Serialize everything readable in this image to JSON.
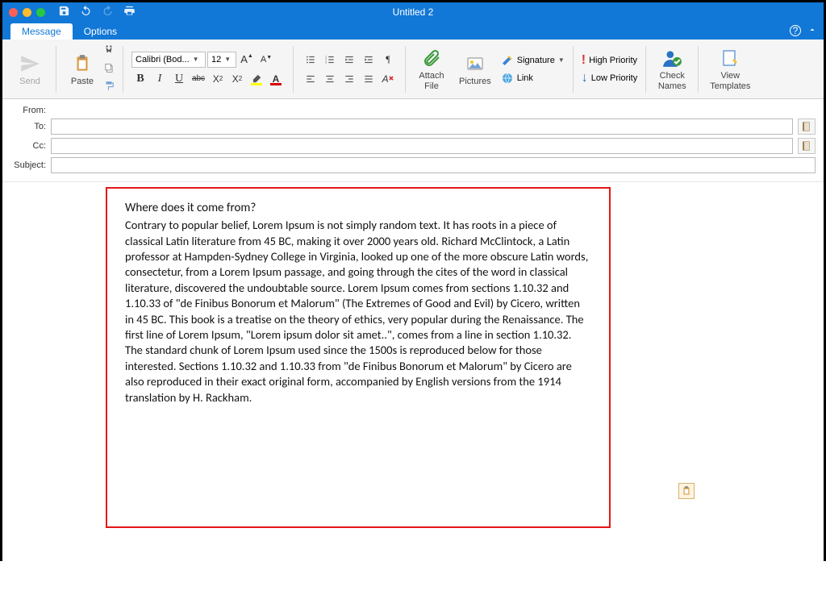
{
  "window": {
    "title": "Untitled 2"
  },
  "tabs": {
    "message": "Message",
    "options": "Options"
  },
  "ribbon": {
    "send": "Send",
    "paste": "Paste",
    "font_name": "Calibri (Bod...",
    "font_size": "12",
    "attach_file": "Attach\nFile",
    "pictures": "Pictures",
    "signature": "Signature",
    "link": "Link",
    "high_priority": "High Priority",
    "low_priority": "Low Priority",
    "check_names": "Check\nNames",
    "view_templates": "View\nTemplates"
  },
  "fields": {
    "from": "From:",
    "to": "To:",
    "cc": "Cc:",
    "subject": "Subject:"
  },
  "body": {
    "heading": "Where does it come from?",
    "paragraph": "Contrary to popular belief, Lorem Ipsum is not simply random text. It has roots in a piece of classical Latin literature from 45 BC, making it over 2000 years old. Richard McClintock, a Latin professor at Hampden-Sydney College in Virginia, looked up one of the more obscure Latin words, consectetur, from a Lorem Ipsum passage, and going through the cites of the word in classical literature, discovered the undoubtable source. Lorem Ipsum comes from sections 1.10.32 and 1.10.33 of \"de Finibus Bonorum et Malorum\" (The Extremes of Good and Evil) by Cicero, written in 45 BC. This book is a treatise on the theory of ethics, very popular during the Renaissance. The first line of Lorem Ipsum, \"Lorem ipsum dolor sit amet..\", comes from a line in section 1.10.32. The standard chunk of Lorem Ipsum used since the 1500s is reproduced below for those interested. Sections 1.10.32 and 1.10.33 from \"de Finibus Bonorum et Malorum\" by Cicero are also reproduced in their exact original form, accompanied by English versions from the 1914 translation by H. Rackham."
  }
}
